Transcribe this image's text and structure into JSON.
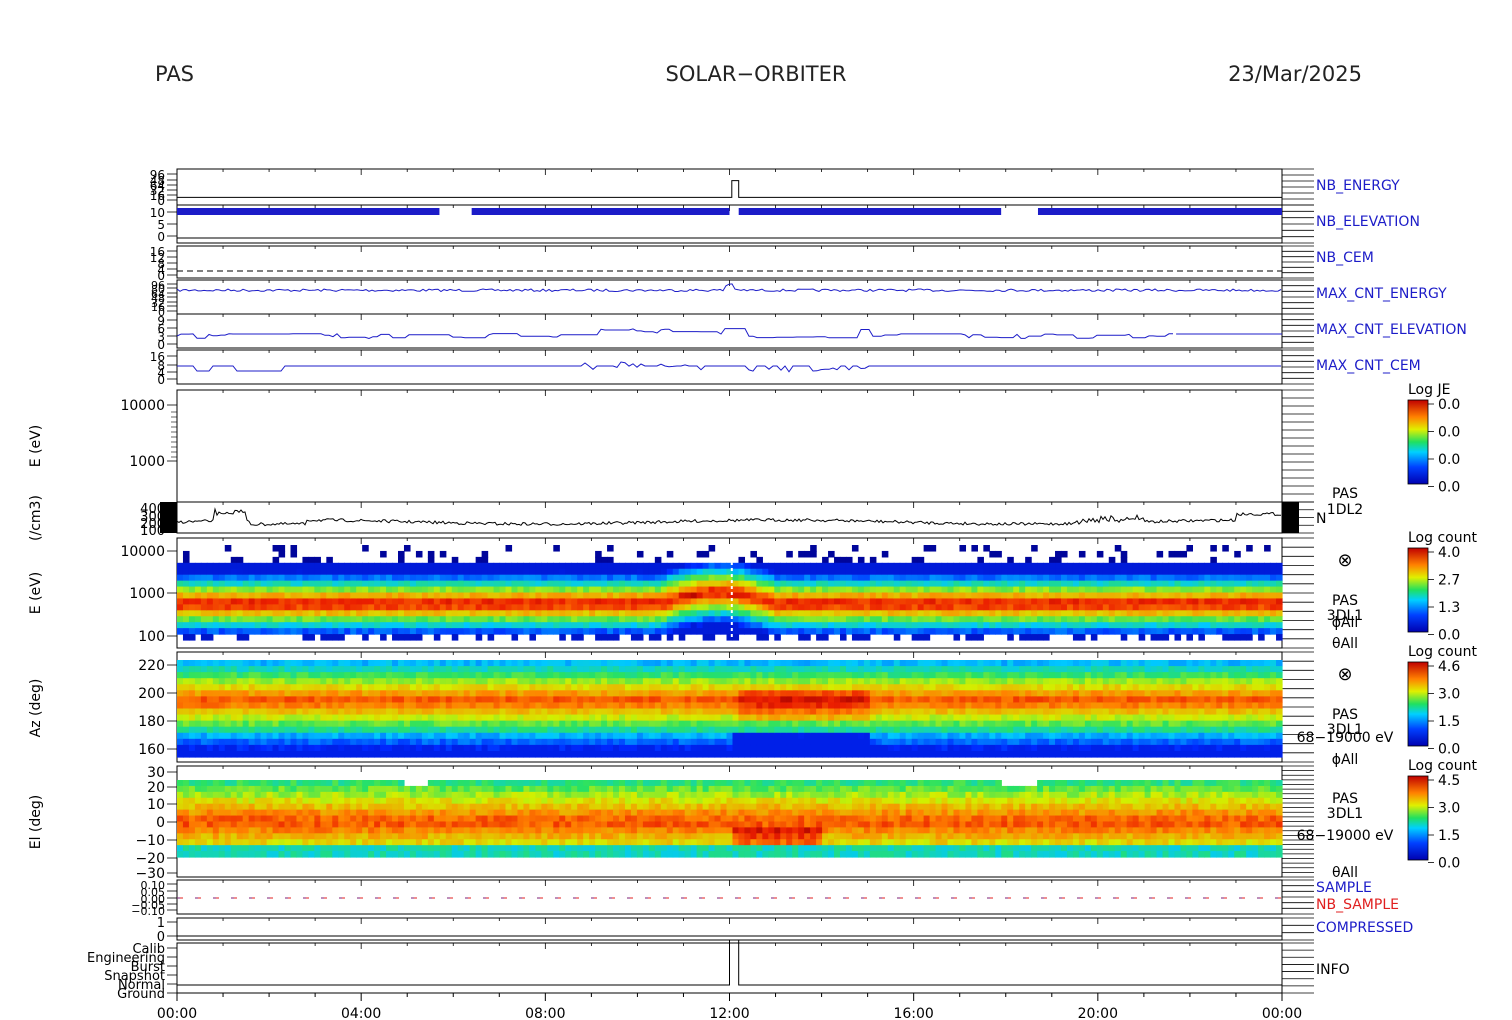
{
  "header": {
    "instrument": "PAS",
    "mission": "SOLAR−ORBITER",
    "date": "23/Mar/2025"
  },
  "chart_data": {
    "type": "heatmap",
    "title": "SOLAR−ORBITER",
    "x_ticks": [
      "00:00",
      "04:00",
      "08:00",
      "12:00",
      "16:00",
      "20:00",
      "00:00"
    ],
    "x_range_hours": [
      0,
      24
    ],
    "colors": {
      "trace": "#1c1cc8",
      "ground": "#000000",
      "nb_sample": "#e02020"
    },
    "panels": [
      {
        "id": "nb_energy",
        "label": "NB_ENERGY",
        "label_color": "#1c1cc8",
        "y_ticks": [
          "96",
          "48",
          "64",
          "32",
          "16",
          "0"
        ],
        "series": [
          [
            0,
            0.15
          ],
          [
            12.05,
            0.15
          ],
          [
            12.05,
            0.85
          ],
          [
            12.2,
            0.85
          ],
          [
            12.2,
            0.15
          ],
          [
            24,
            0.15
          ]
        ]
      },
      {
        "id": "nb_elevation",
        "label": "NB_ELEVATION",
        "label_color": "#1c1cc8",
        "y_ticks": [
          "10",
          "5",
          "0"
        ],
        "dense_segments": [
          [
            0,
            5.7
          ],
          [
            6.4,
            12.0
          ],
          [
            12.2,
            17.9
          ],
          [
            18.7,
            24
          ]
        ]
      },
      {
        "id": "nb_cem",
        "label": "NB_CEM",
        "label_color": "#1c1cc8",
        "y_ticks": [
          "16",
          "12",
          "8",
          "4",
          "0"
        ]
      },
      {
        "id": "max_cnt_energy",
        "label": "MAX_CNT_ENERGY",
        "label_color": "#1c1cc8",
        "y_ticks": [
          "96",
          "80",
          "64",
          "48",
          "32",
          "16",
          "0"
        ]
      },
      {
        "id": "max_cnt_elevation",
        "label": "MAX_CNT_ELEVATION",
        "label_color": "#1c1cc8",
        "y_ticks": [
          "9",
          "6",
          "3",
          "0"
        ]
      },
      {
        "id": "max_cnt_cem",
        "label": "MAX_CNT_CEM",
        "label_color": "#1c1cc8",
        "y_ticks": [
          "16",
          "8",
          "4",
          "0"
        ]
      },
      {
        "id": "je",
        "ylabel": "E (eV)",
        "y_ticks": [
          "10000",
          "1000"
        ],
        "colorbar": {
          "title": "Log JE",
          "ticks": [
            "0.0",
            "0.0",
            "0.0",
            "0.0"
          ]
        }
      },
      {
        "id": "density",
        "ylabel": "(/cm3)",
        "y_ticks": [
          "400",
          "300",
          "200",
          "100"
        ],
        "label": "N",
        "annotation": [
          "PAS",
          "1DL2"
        ]
      },
      {
        "id": "energy_spectrogram",
        "ylabel": "E (eV)",
        "y_ticks": [
          "10000",
          "1000",
          "100"
        ],
        "colorbar": {
          "title": "Log count",
          "ticks": [
            "4.0",
            "2.7",
            "1.3",
            "0.0"
          ]
        },
        "annotation": [
          "PAS",
          "3DL1",
          "ϕAll",
          "θAll"
        ]
      },
      {
        "id": "azimuth_spectrogram",
        "ylabel": "Az (deg)",
        "y_ticks": [
          "220",
          "200",
          "180",
          "160"
        ],
        "colorbar": {
          "title": "Log count",
          "ticks": [
            "4.6",
            "3.0",
            "1.5",
            "0.0"
          ]
        },
        "annotation": [
          "PAS",
          "3DL1",
          "68−19000 eV",
          "ϕAll"
        ]
      },
      {
        "id": "elevation_spectrogram",
        "ylabel": "El (deg)",
        "y_ticks": [
          "30",
          "20",
          "10",
          "0",
          "−10",
          "−20",
          "−30"
        ],
        "colorbar": {
          "title": "Log count",
          "ticks": [
            "4.5",
            "3.0",
            "1.5",
            "0.0"
          ]
        },
        "annotation": [
          "PAS",
          "3DL1",
          "68−19000 eV",
          "θAll"
        ]
      },
      {
        "id": "sample",
        "labels": [
          "SAMPLE",
          "NB_SAMPLE"
        ],
        "label_colors": [
          "#1c1cc8",
          "#e02020"
        ],
        "y_ticks": [
          "0.10",
          "0.05",
          "0.00",
          "−0.05",
          "−0.10"
        ]
      },
      {
        "id": "compressed",
        "label": "COMPRESSED",
        "label_color": "#1c1cc8",
        "y_ticks": [
          "1",
          "0"
        ]
      },
      {
        "id": "info",
        "label": "INFO",
        "label_color": "#1c1cc8",
        "y_ticks": [
          "Calib",
          "Engineering",
          "Burst",
          "Snapshot",
          "Normal",
          "Ground"
        ],
        "series": [
          [
            0,
            "Ground"
          ],
          [
            12.0,
            "Ground"
          ],
          [
            12.0,
            "Calib"
          ],
          [
            12.2,
            "Calib"
          ],
          [
            12.2,
            "Ground"
          ],
          [
            24,
            "Ground"
          ]
        ]
      }
    ]
  }
}
